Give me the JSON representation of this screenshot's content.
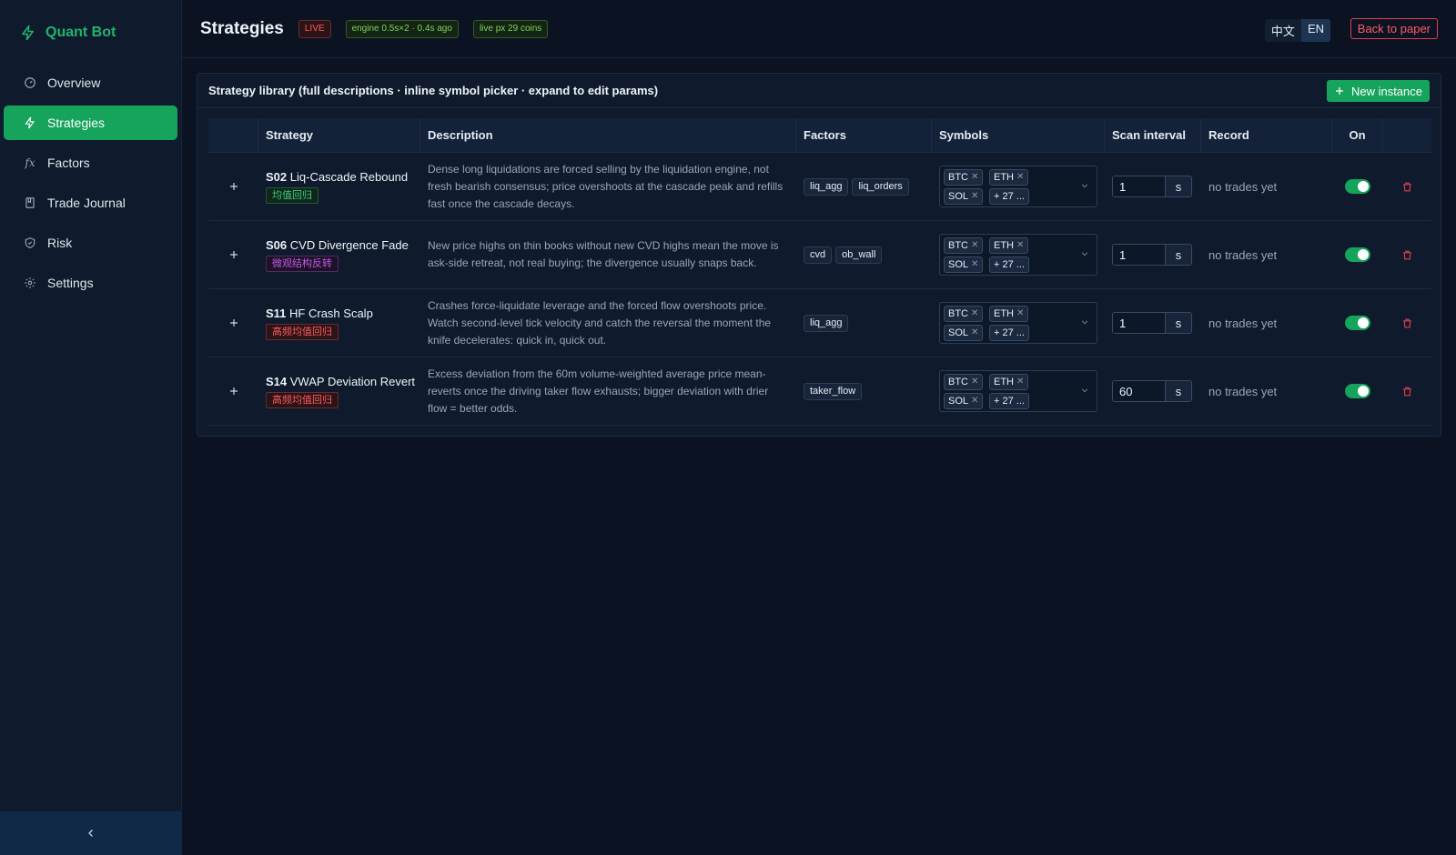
{
  "brand": {
    "name": "Quant Bot",
    "icon": "bolt-icon"
  },
  "sidebar": {
    "items": [
      {
        "label": "Overview",
        "icon": "gauge-icon",
        "active": false
      },
      {
        "label": "Strategies",
        "icon": "bolt-icon",
        "active": true
      },
      {
        "label": "Factors",
        "icon": "fx-icon",
        "active": false
      },
      {
        "label": "Trade Journal",
        "icon": "book-icon",
        "active": false
      },
      {
        "label": "Risk",
        "icon": "shield-icon",
        "active": false
      },
      {
        "label": "Settings",
        "icon": "gear-icon",
        "active": false
      }
    ],
    "collapse_icon": "chevron-left-icon"
  },
  "header": {
    "title": "Strategies",
    "badges": {
      "live": "LIVE",
      "engine": "engine 0.5s×2 · 0.4s ago",
      "live_px": "live px 29 coins"
    },
    "lang": {
      "zh": "中文",
      "en": "EN",
      "selected": "EN"
    },
    "back_label": "Back to paper"
  },
  "panel": {
    "title": "Strategy library (full descriptions · inline symbol picker · expand to edit params)",
    "new_button_label": "New instance",
    "columns": {
      "strategy": "Strategy",
      "description": "Description",
      "factors": "Factors",
      "symbols": "Symbols",
      "scan": "Scan interval",
      "record": "Record",
      "on": "On"
    },
    "rows": [
      {
        "code": "S02",
        "name": "Liq-Cascade Rebound",
        "tag": "均值回归",
        "description": "Dense long liquidations are forced selling by the liquidation engine, not fresh bearish consensus; price overshoots at the cascade peak and refills fast once the cascade decays.",
        "factors": [
          "liq_agg",
          "liq_orders"
        ],
        "symbols": [
          "BTC",
          "ETH",
          "SOL"
        ],
        "more": "+ 27 ...",
        "scan": "1",
        "unit": "s",
        "record": "no trades yet",
        "enabled": true
      },
      {
        "code": "S06",
        "name": "CVD Divergence Fade",
        "tag": "微观结构反转",
        "description": "New price highs on thin books without new CVD highs mean the move is ask-side retreat, not real buying; the divergence usually snaps back.",
        "factors": [
          "cvd",
          "ob_wall"
        ],
        "symbols": [
          "BTC",
          "ETH",
          "SOL"
        ],
        "more": "+ 27 ...",
        "scan": "1",
        "unit": "s",
        "record": "no trades yet",
        "enabled": true
      },
      {
        "code": "S11",
        "name": "HF Crash Scalp",
        "tag": "高频均值回归",
        "description": "Crashes force-liquidate leverage and the forced flow overshoots price. Watch second-level tick velocity and catch the reversal the moment the knife decelerates: quick in, quick out.",
        "factors": [
          "liq_agg"
        ],
        "symbols": [
          "BTC",
          "ETH",
          "SOL"
        ],
        "more": "+ 27 ...",
        "scan": "1",
        "unit": "s",
        "record": "no trades yet",
        "enabled": true
      },
      {
        "code": "S14",
        "name": "VWAP Deviation Revert",
        "tag": "高频均值回归",
        "description": "Excess deviation from the 60m volume-weighted average price mean-reverts once the driving taker flow exhausts; bigger deviation with drier flow = better odds.",
        "factors": [
          "taker_flow"
        ],
        "symbols": [
          "BTC",
          "ETH",
          "SOL"
        ],
        "more": "+ 27 ...",
        "scan": "60",
        "unit": "s",
        "record": "no trades yet",
        "enabled": true
      }
    ]
  },
  "colors": {
    "accent": "#16a35c",
    "danger": "#e04050",
    "background": "#0b1322",
    "surface": "#0f1b2c"
  }
}
